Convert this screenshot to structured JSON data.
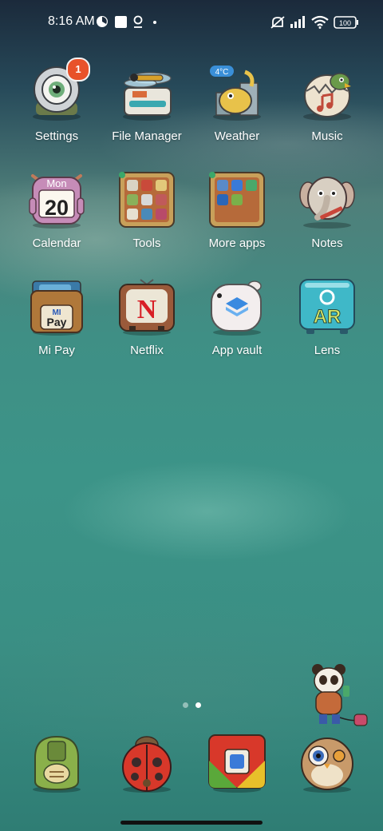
{
  "status_bar": {
    "time": "8:16 AM",
    "battery": "100",
    "icons": [
      "pie-icon",
      "square-icon",
      "location-pin-icon",
      "dot-icon",
      "mute-icon",
      "signal-icon",
      "wifi-icon",
      "battery-icon"
    ]
  },
  "apps": [
    {
      "label": "Settings",
      "icon": "settings-eyeball-icon",
      "badge": "1"
    },
    {
      "label": "File Manager",
      "icon": "dragonfly-drawer-icon"
    },
    {
      "label": "Weather",
      "icon": "bird-city-icon",
      "temp": "4°C"
    },
    {
      "label": "Music",
      "icon": "bird-egg-icon"
    },
    {
      "label": "Calendar",
      "icon": "monster-calendar-icon",
      "day": "Mon",
      "date": "20"
    },
    {
      "label": "Tools",
      "icon": "tools-folder-icon"
    },
    {
      "label": "More apps",
      "icon": "more-apps-folder-icon"
    },
    {
      "label": "Notes",
      "icon": "elephant-icon"
    },
    {
      "label": "Mi Pay",
      "icon": "wallet-icon",
      "mi": "MI",
      "pay": "Pay"
    },
    {
      "label": "Netflix",
      "icon": "retro-tv-icon",
      "letter": "N"
    },
    {
      "label": "App vault",
      "icon": "bunny-vault-icon"
    },
    {
      "label": "Lens",
      "icon": "ar-lens-icon",
      "text": "AR"
    }
  ],
  "dock": [
    {
      "icon": "turtle-phone-icon"
    },
    {
      "icon": "ladybug-icon"
    },
    {
      "icon": "chrome-box-icon"
    },
    {
      "icon": "owl-camera-icon"
    }
  ],
  "pages": {
    "count": 2,
    "active": 1
  },
  "colors": {
    "badge": "#e8522a",
    "calendar_top": "#c08ab8",
    "netflix_red": "#d81f26",
    "lens_teal": "#3fb8c8"
  }
}
